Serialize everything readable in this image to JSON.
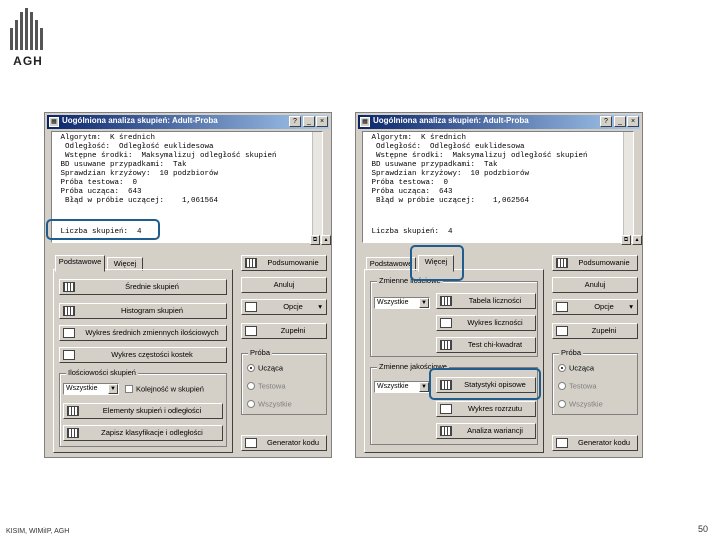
{
  "logo_text": "AGH",
  "footer": "KISIM, WIMiIP, AGH",
  "page_number": "50",
  "highlight_color": "#1f5d8f",
  "left_window": {
    "title": "Uogólniona analiza skupień: Adult-Proba",
    "title_buttons": [
      "?",
      "_",
      "×"
    ],
    "output_lines": [
      " Algorytm:  K średnich",
      "  Odległość:  Odległość euklidesowa",
      "  Wstępne środki:  Maksymalizuj odległość skupień",
      " BD usuwane przypadkami:  Tak",
      " Sprawdzian krzyżowy:  10 podzbiorów",
      " Próba testowa:  0",
      " Próba ucząca:  643",
      "  Błąd w próbie uczącej:    1,061564"
    ],
    "cluster_line": " Liczba skupień:  4",
    "tabs": [
      "Podstawowe",
      "Więcej"
    ],
    "buttons": [
      "Średnie skupień",
      "Histogram skupień",
      "Wykres średnich zmiennych ilościowych",
      "Wykres częstości kostek"
    ],
    "group_label": "Ilościowości skupień",
    "combo_value": "Wszystkie",
    "checkbox_label": "Kolejność w skupień",
    "bottom_buttons": [
      "Elementy skupień i odległości",
      "Zapisz klasyfikacje i odległości"
    ],
    "side_buttons": {
      "summary": "Podsumowanie",
      "cancel": "Anuluj",
      "options": "Opcje",
      "cases": "Zupełni"
    },
    "sample_group": "Próba",
    "radios": [
      "Ucząca",
      "Testowa",
      "Wszystkie"
    ],
    "codegen": "Generator kodu"
  },
  "right_window": {
    "title": "Uogólniona analiza skupień: Adult-Proba",
    "title_buttons": [
      "?",
      "_",
      "×"
    ],
    "output_lines": [
      " Algorytm:  K średnich",
      "  Odległość:  Odległość euklidesowa",
      "  Wstępne środki:  Maksymalizuj odległość skupień",
      " BD usuwane przypadkami:  Tak",
      " Sprawdzian krzyżowy:  10 podzbiorów",
      " Próba testowa:  0",
      " Próba ucząca:  643",
      "  Błąd w próbie uczącej:    1,062564"
    ],
    "cluster_line": " Liczba skupień:  4",
    "tabs": [
      "Podstawowe",
      "Więcej"
    ],
    "group_quant": "Zmienne ilościowe",
    "combo1": "Wszystkie",
    "quant_buttons": [
      "Tabela liczności",
      "Wykres liczności",
      "Test chi-kwadrat"
    ],
    "group_cat": "Zmienne jakościowe",
    "combo2": "Wszystkie",
    "cat_buttons": [
      "Statystyki opisowe",
      "Wykres rozrzutu",
      "Analiza wariancji"
    ],
    "side_buttons": {
      "summary": "Podsumowanie",
      "cancel": "Anuluj",
      "options": "Opcje",
      "cases": "Zupełni"
    },
    "sample_group": "Próba",
    "radios": [
      "Ucząca",
      "Testowa",
      "Wszystkie"
    ],
    "codegen": "Generator kodu"
  }
}
